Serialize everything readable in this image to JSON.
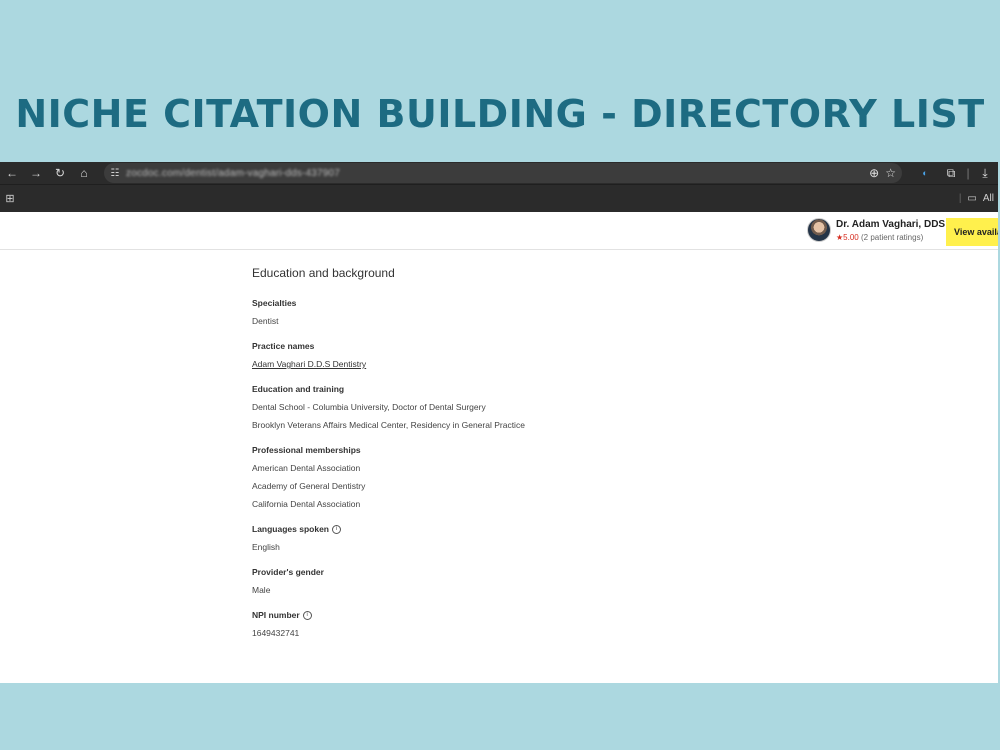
{
  "headline": "NICHE CITATION BUILDING - DIRECTORY LIST",
  "browser": {
    "icons": [
      "back-icon",
      "forward-icon",
      "reload-icon",
      "home-icon"
    ],
    "url": "zocdoc.com/dentist/adam-vaghari-dds-437907",
    "bookmarks_right": "All"
  },
  "header": {
    "doctor_name": "Dr. Adam Vaghari, DDS",
    "star": "★",
    "rating_score": "5.00",
    "rating_count": "(2 patient ratings)",
    "cta_label": "View availability"
  },
  "profile": {
    "section_title": "Education and background",
    "specialties": {
      "label": "Specialties",
      "values": [
        "Dentist"
      ]
    },
    "practice_names": {
      "label": "Practice names",
      "values": [
        "Adam Vaghari D.D.S Dentistry"
      ]
    },
    "education": {
      "label": "Education and training",
      "values": [
        "Dental School - Columbia University, Doctor of Dental Surgery",
        "Brooklyn Veterans Affairs Medical Center, Residency in General Practice"
      ]
    },
    "memberships": {
      "label": "Professional memberships",
      "values": [
        "American Dental Association",
        "Academy of General Dentistry",
        "California Dental Association"
      ]
    },
    "languages": {
      "label": "Languages spoken",
      "values": [
        "English"
      ]
    },
    "gender": {
      "label": "Provider's gender",
      "values": [
        "Male"
      ]
    },
    "npi": {
      "label": "NPI number",
      "values": [
        "1649432741"
      ]
    }
  },
  "colors": {
    "background": "#acd8e0",
    "headline": "#1d6b82",
    "cta": "#fff04d",
    "star": "#d62d20"
  }
}
